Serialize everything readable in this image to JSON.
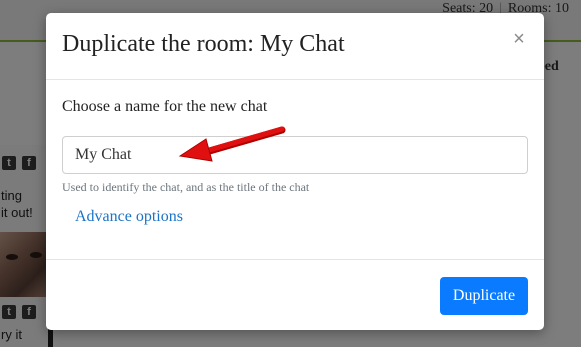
{
  "background": {
    "stats": {
      "seats_label": "Seats: 20",
      "rooms_label": "Rooms: 10"
    },
    "partial_tab": "bed",
    "promo_text_1": "ting",
    "promo_text_2": "it out!",
    "promo_text_3": "ry it"
  },
  "modal": {
    "title": "Duplicate the room: My Chat",
    "close_symbol": "×",
    "name_label": "Choose a name for the new chat",
    "name_value": "My Chat",
    "help_text": "Used to identify the chat, and as the title of the chat",
    "advance_link": "Advance options",
    "duplicate_button": "Duplicate"
  },
  "colors": {
    "primary": "#0a7bff",
    "link": "#1a73c7",
    "annotation_arrow": "#e01010",
    "top_accent": "#8bb83a"
  },
  "icons": [
    "close-icon",
    "twitter-icon",
    "facebook-icon",
    "annotation-arrow-icon"
  ]
}
